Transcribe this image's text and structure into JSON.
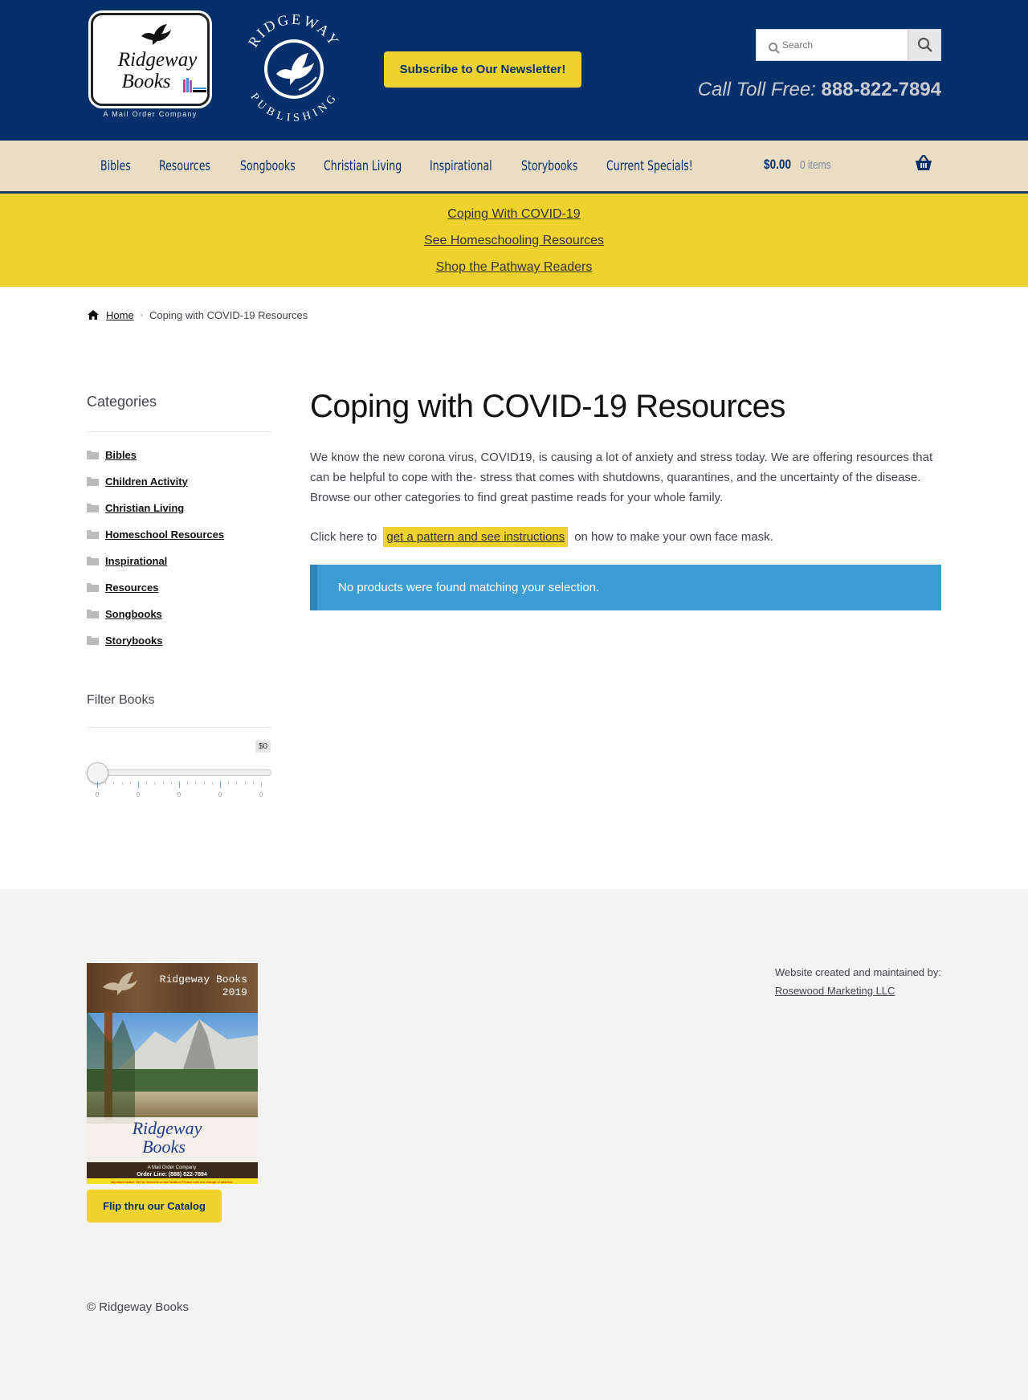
{
  "header": {
    "logo_books": {
      "name_line1": "Ridgeway",
      "name_line2": "Books",
      "tagline": "A Mail Order Company"
    },
    "logo_publishing": {
      "text_top": "RIDGEWAY",
      "text_bottom": "PUBLISHING"
    },
    "newsletter_label": "Subscribe to Our Newsletter!",
    "search_placeholder": "Search",
    "toll_free_label": "Call Toll Free:",
    "toll_free_number": "888-822-7894",
    "colors": {
      "header_bg": "#03306a",
      "accent_yellow": "#efd22d",
      "nav_bg": "#ebdcc4"
    }
  },
  "nav": {
    "items": [
      {
        "label": "Bibles"
      },
      {
        "label": "Resources"
      },
      {
        "label": "Songbooks"
      },
      {
        "label": "Christian Living"
      },
      {
        "label": "Inspirational"
      },
      {
        "label": "Storybooks"
      },
      {
        "label": "Current Specials!"
      }
    ],
    "cart_amount": "$0.00",
    "cart_count": "0 items",
    "cart_icon": "basket-icon"
  },
  "promo": {
    "links": [
      {
        "label": "Coping With COVID-19"
      },
      {
        "label": "See Homeschooling Resources"
      },
      {
        "label": "Shop the Pathway Readers"
      }
    ]
  },
  "breadcrumb": {
    "home_label": "Home",
    "current": "Coping with COVID-19 Resources"
  },
  "sidebar": {
    "categories_title": "Categories",
    "categories": [
      {
        "label": "Bibles"
      },
      {
        "label": "Children Activity"
      },
      {
        "label": "Christian Living"
      },
      {
        "label": "Homeschool Resources"
      },
      {
        "label": "Inspirational"
      },
      {
        "label": "Resources"
      },
      {
        "label": "Songbooks"
      },
      {
        "label": "Storybooks"
      }
    ],
    "filter_title": "Filter Books",
    "slider": {
      "value_label": "$0",
      "value_fraction": 0,
      "tick_labels": [
        "0",
        "0",
        "0",
        "0",
        "0"
      ]
    }
  },
  "main": {
    "title": "Coping with COVID-19 Resources",
    "intro": "We know the new corona virus, COVID19, is causing a lot of anxiety and stress today. We are offering resources that can be helpful to cope with the· stress that comes with shutdowns, quarantines, and the uncertainty of the disease. Browse our other categories to find great pastime reads for your whole family.",
    "mask_prefix": "Click here to",
    "mask_link": "get a pattern and see instructions",
    "mask_suffix": "on how to make your own face mask.",
    "notice": "No products were found matching your selection."
  },
  "footer": {
    "catalog_cover": {
      "title": "Ridgeway Books",
      "year": "2019",
      "brand_line1": "Ridgeway",
      "brand_line2": "Books",
      "sub1": "A Mail Order Company",
      "sub2": "Order Line: (888) 822-7894",
      "notice_strip": "Important Notice: We've moved to a new location! Please note our change of address."
    },
    "catalog_button": "Flip thru our Catalog",
    "credit_label": "Website created and maintained by:",
    "credit_link": "Rosewood Marketing LLC",
    "copyright": "© Ridgeway Books"
  }
}
